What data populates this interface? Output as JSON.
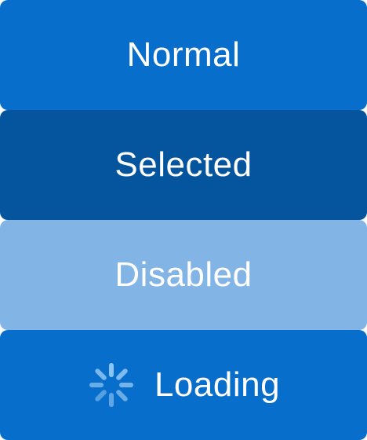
{
  "buttons": {
    "normal": {
      "label": "Normal"
    },
    "selected": {
      "label": "Selected"
    },
    "disabled": {
      "label": "Disabled"
    },
    "loading": {
      "label": "Loading",
      "icon": "spinner-icon"
    }
  },
  "colors": {
    "normal": "#086ECB",
    "selected": "#04559D",
    "disabled": "#82B5E6",
    "loading": "#086ECB",
    "text": "#FFFFFF",
    "spinner": "#8CC4F2"
  }
}
